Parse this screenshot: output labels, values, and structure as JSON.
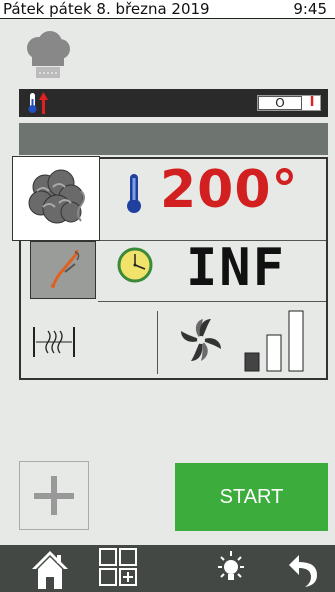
{
  "statusbar": {
    "date": "Pátek pátek 8. března 2019",
    "time": "9:45"
  },
  "header": {
    "chef_icon": "chef-hat-icon"
  },
  "darkbar": {
    "thermometer_icon": "thermometer-up-icon",
    "toggle_off": "O",
    "toggle_on": "I"
  },
  "panel": {
    "mode_icon": "combi-steam-icon",
    "probe_icon": "core-probe-icon",
    "temperature": "200°",
    "time": "INF",
    "steam_icon": "humidity-icon",
    "fan_icon": "fan-icon",
    "fan_speed_level": 1,
    "fan_speed_max": 3
  },
  "actions": {
    "add_icon": "plus-icon",
    "start_label": "START"
  },
  "bottombar": [
    "home-icon",
    "programs-grid-icon",
    "light-icon",
    "back-icon"
  ],
  "colors": {
    "accent_red": "#d21f1f",
    "start_green": "#3cac3c",
    "bottom_bar": "#444844"
  }
}
